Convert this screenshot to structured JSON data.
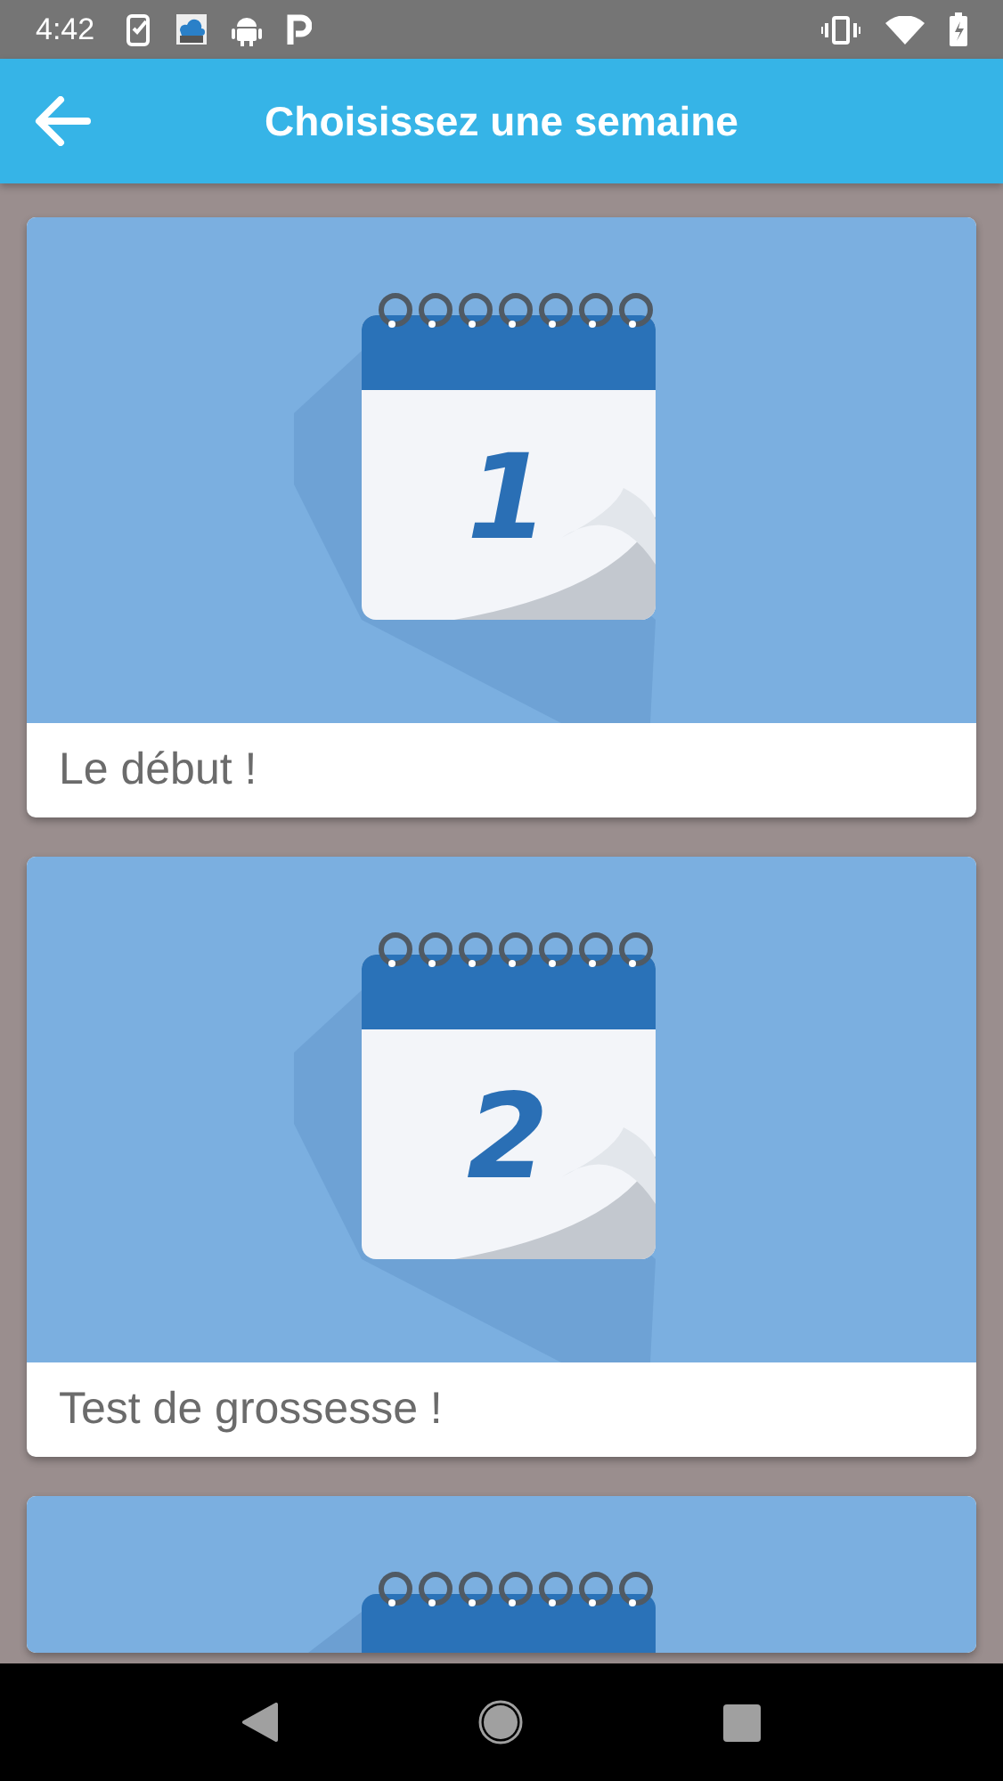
{
  "status_bar": {
    "time": "4:42"
  },
  "app_bar": {
    "title": "Choisissez une semaine"
  },
  "cards": [
    {
      "kind": "full",
      "number": "1",
      "caption": "Le début !"
    },
    {
      "kind": "full",
      "number": "2",
      "caption": "Test de grossesse !"
    },
    {
      "kind": "cut"
    }
  ]
}
